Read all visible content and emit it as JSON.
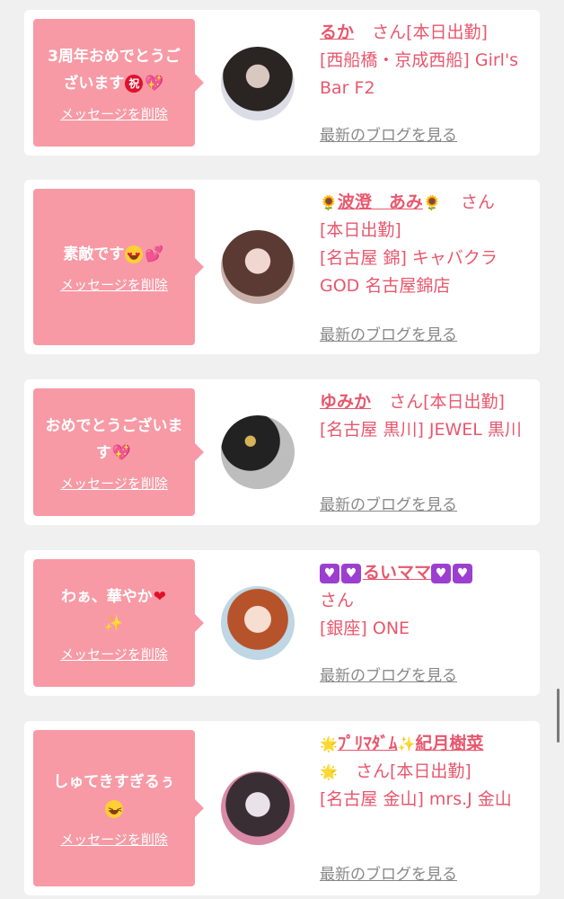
{
  "colors": {
    "bubble": "#f79aa5",
    "link_pink": "#e8576d",
    "gray_link": "#888888",
    "background": "#f0f0f0"
  },
  "cards": [
    {
      "message": "3周年おめでとうございます",
      "message_icons": [
        "iwai-icon",
        "sparkling-heart-icon"
      ],
      "delete_label": "メッセージを削除",
      "name": "るか",
      "san": "さん",
      "status": "[本日出勤]",
      "shop": "[西船橋・京成西船] Girl's Bar F2",
      "blog_label": "最新のブログを見る"
    },
    {
      "message": "素敵です",
      "message_icons": [
        "heart-eyes-icon",
        "two-hearts-icon"
      ],
      "delete_label": "メッセージを削除",
      "name": "波澄　あみ",
      "name_icons": [
        "sunflower-icon",
        "sunflower-icon"
      ],
      "san": "さん",
      "status": "[本日出勤]",
      "shop": "[名古屋 錦] キャバクラ GOD 名古屋錦店",
      "blog_label": "最新のブログを見る"
    },
    {
      "message": "おめでとうございます",
      "message_icons": [
        "sparkling-heart-icon"
      ],
      "delete_label": "メッセージを削除",
      "name": "ゆみか",
      "san": "さん",
      "status": "[本日出勤]",
      "shop": "[名古屋 黒川] JEWEL 黒川",
      "blog_label": "最新のブログを見る"
    },
    {
      "message": "わぁ、華やか",
      "message_icons": [
        "red-heart-icon",
        "sparkles-icon"
      ],
      "delete_label": "メッセージを削除",
      "name": "るいママ",
      "name_icons": [
        "heart-box-icon",
        "heart-box-icon",
        "heart-box-icon",
        "heart-box-icon"
      ],
      "san": "さん",
      "status": "",
      "shop": "[銀座] ONE",
      "blog_label": "最新のブログを見る"
    },
    {
      "message": "しゅてきすぎるぅ",
      "message_icons": [
        "laughing-face-icon"
      ],
      "delete_label": "メッセージを削除",
      "name_prefix": "ﾌﾟﾘﾏﾀﾞﾑ",
      "name": "紀月樹菜",
      "name_icons": [
        "glowing-star-icon",
        "sparkles-icon",
        "glowing-star-icon"
      ],
      "san": "さん",
      "status": "[本日出勤]",
      "shop": "[名古屋 金山] mrs.J 金山",
      "blog_label": "最新のブログを見る"
    }
  ]
}
